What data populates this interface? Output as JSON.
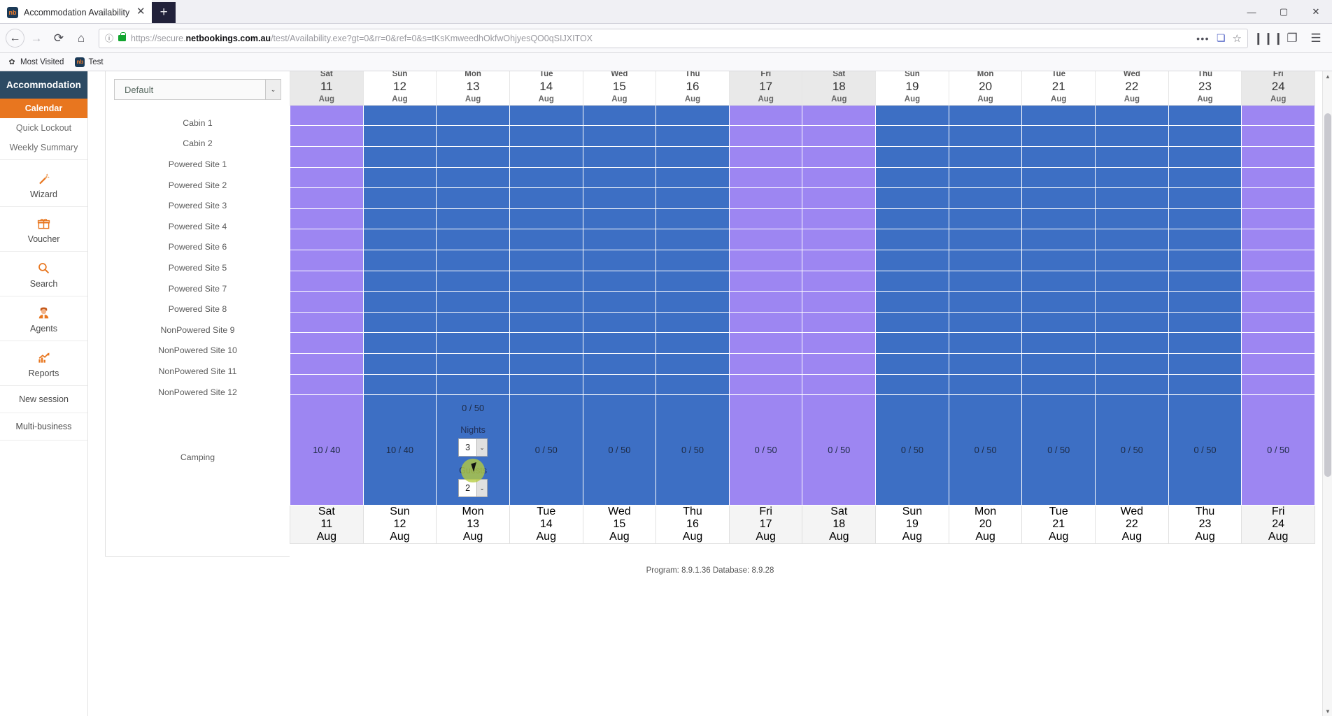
{
  "browser": {
    "tab": {
      "title": "Accommodation Availability",
      "favicon_text": "nb",
      "close_label": "✕"
    },
    "newtab_label": "+",
    "window_controls": {
      "minimize": "—",
      "maximize": "▢",
      "close": "✕"
    },
    "nav": {
      "back": "←",
      "forward": "→",
      "reload": "⟳",
      "home": "⌂"
    },
    "url": {
      "full": "https://secure.netbookings.com.au/test/Availability.exe?gt=0&rr=0&ref=0&s=tKsKmweedhOkfwOhjyesQO0qSIJXITOX",
      "scheme": "https://secure.",
      "host": "netbookings.com.au",
      "path": "/test/Availability.exe?gt=0&rr=0&ref=0&s=tKsKmweedhOkfwOhjyesQO0qSIJXITOX",
      "info_icon": "ⓘ",
      "lock_icon": "padlock-icon"
    },
    "url_actions": {
      "menu_dots": "•••",
      "pocket": "❏",
      "bookmark_star": "☆"
    },
    "toolbar_right": {
      "library": "❙❙❙",
      "sidebar": "❐",
      "menu": "☰"
    },
    "bookmarks": [
      {
        "icon": "✿",
        "label": "Most Visited"
      },
      {
        "icon": "nb",
        "label": "Test"
      }
    ]
  },
  "sidebar": {
    "header": "Accommodation",
    "sub_items": [
      {
        "label": "Calendar",
        "active": true
      },
      {
        "label": "Quick Lockout",
        "active": false
      },
      {
        "label": "Weekly Summary",
        "active": false
      }
    ],
    "icon_items": [
      {
        "icon": "magic-wand-icon",
        "glyph": "🪄",
        "label": "Wizard"
      },
      {
        "icon": "gift-icon",
        "glyph": "🎁",
        "label": "Voucher"
      },
      {
        "icon": "search-icon",
        "glyph": "🔍",
        "label": "Search"
      },
      {
        "icon": "agent-person-icon",
        "glyph": "👩‍💼",
        "label": "Agents"
      },
      {
        "icon": "chart-growth-icon",
        "glyph": "📈",
        "label": "Reports"
      }
    ],
    "plain_items": [
      {
        "label": "New session"
      },
      {
        "label": "Multi-business"
      }
    ]
  },
  "panel": {
    "filter_select": {
      "value": "Default",
      "arrow": "⌄"
    },
    "rooms": [
      "Cabin 1",
      "Cabin 2",
      "Powered Site 1",
      "Powered Site 2",
      "Powered Site 3",
      "Powered Site 4",
      "Powered Site 6",
      "Powered Site 5",
      "Powered Site 7",
      "Powered Site 8",
      "NonPowered Site 9",
      "NonPowered Site 10",
      "NonPowered Site 11",
      "NonPowered Site 12"
    ],
    "camping_label": "Camping"
  },
  "calendar": {
    "days": [
      {
        "dow": "Sat",
        "num": "11",
        "mon": "Aug",
        "highlight": true
      },
      {
        "dow": "Sun",
        "num": "12",
        "mon": "Aug",
        "highlight": false
      },
      {
        "dow": "Mon",
        "num": "13",
        "mon": "Aug",
        "highlight": false
      },
      {
        "dow": "Tue",
        "num": "14",
        "mon": "Aug",
        "highlight": false
      },
      {
        "dow": "Wed",
        "num": "15",
        "mon": "Aug",
        "highlight": false
      },
      {
        "dow": "Thu",
        "num": "16",
        "mon": "Aug",
        "highlight": false
      },
      {
        "dow": "Fri",
        "num": "17",
        "mon": "Aug",
        "highlight": true
      },
      {
        "dow": "Sat",
        "num": "18",
        "mon": "Aug",
        "highlight": true
      },
      {
        "dow": "Sun",
        "num": "19",
        "mon": "Aug",
        "highlight": false
      },
      {
        "dow": "Mon",
        "num": "20",
        "mon": "Aug",
        "highlight": false
      },
      {
        "dow": "Tue",
        "num": "21",
        "mon": "Aug",
        "highlight": false
      },
      {
        "dow": "Wed",
        "num": "22",
        "mon": "Aug",
        "highlight": false
      },
      {
        "dow": "Thu",
        "num": "23",
        "mon": "Aug",
        "highlight": false
      },
      {
        "dow": "Fri",
        "num": "24",
        "mon": "Aug",
        "highlight": true
      }
    ],
    "camping_row": {
      "values": [
        "10 / 40",
        "10 / 40",
        "0 / 50",
        "0 / 50",
        "0 / 50",
        "0 / 50",
        "0 / 50",
        "0 / 50",
        "0 / 50",
        "0 / 50",
        "0 / 50",
        "0 / 50",
        "0 / 50",
        "0 / 50"
      ],
      "editor_col_index": 2,
      "editor": {
        "count": "0 / 50",
        "nights_label": "Nights",
        "nights_value": "3",
        "guests_label": "Guests",
        "guests_value": "2",
        "arrow": "⌄"
      }
    }
  },
  "footer": {
    "program_info": "Program: 8.9.1.36 Database: 8.9.28"
  },
  "colors": {
    "sidebar_header": "#2c4a63",
    "accent_orange": "#e8761f",
    "cell_blue": "#3d6fc4",
    "cell_purple": "#9d86f2",
    "cursor_highlight": "#b5cc3f"
  }
}
